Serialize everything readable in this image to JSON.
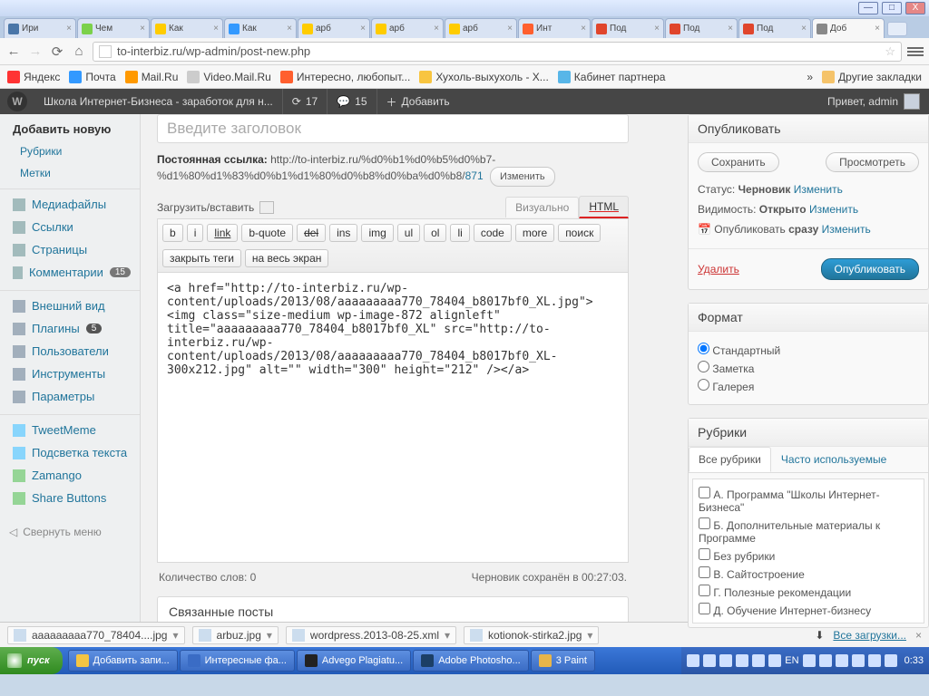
{
  "win_buttons": {
    "min": "—",
    "max": "□",
    "close": "X"
  },
  "browser_tabs": [
    {
      "label": "Ири",
      "color": "#4a76a8"
    },
    {
      "label": "Чем",
      "color": "#7bd14b"
    },
    {
      "label": "Как",
      "color": "#ffcc00"
    },
    {
      "label": "Как",
      "color": "#3399ff"
    },
    {
      "label": "арб",
      "color": "#ffcc00"
    },
    {
      "label": "арб",
      "color": "#ffcc00"
    },
    {
      "label": "арб",
      "color": "#ffcc00"
    },
    {
      "label": "Инт",
      "color": "#ff5f2e"
    },
    {
      "label": "Под",
      "color": "#e0452c"
    },
    {
      "label": "Под",
      "color": "#e0452c"
    },
    {
      "label": "Под",
      "color": "#e0452c"
    },
    {
      "label": "Доб",
      "color": "#888",
      "active": true
    }
  ],
  "omnibox": "to-interbiz.ru/wp-admin/post-new.php",
  "bookmarks": [
    {
      "label": "Яндекс",
      "color": "#ff3333"
    },
    {
      "label": "Почта",
      "color": "#3399ff"
    },
    {
      "label": "Mail.Ru",
      "color": "#ff9900"
    },
    {
      "label": "Video.Mail.Ru",
      "color": "#ccc"
    },
    {
      "label": "Интересно, любопыт...",
      "color": "#ff5f2e"
    },
    {
      "label": "Хухоль-выхухоль - Х...",
      "color": "#f8c540"
    },
    {
      "label": "Кабинет партнера",
      "color": "#58b6e8"
    }
  ],
  "bookmarks_more": "»",
  "bookmarks_other": "Другие закладки",
  "wpbar": {
    "site": "Школа Интернет-Бизнеса - заработок для н...",
    "updates": "17",
    "comments": "15",
    "add": "Добавить",
    "hello": "Привет, admin"
  },
  "sidebar": {
    "addnew": "Добавить новую",
    "sub1": "Рубрики",
    "sub2": "Метки",
    "media": "Медиафайлы",
    "links": "Ссылки",
    "pages": "Страницы",
    "comments": "Комментарии",
    "comments_badge": "15",
    "appearance": "Внешний вид",
    "plugins": "Плагины",
    "plugins_badge": "5",
    "users": "Пользователи",
    "tools": "Инструменты",
    "settings": "Параметры",
    "tweetmeme": "TweetMeme",
    "highlight": "Подсветка текста",
    "zamango": "Zamango",
    "share": "Share Buttons",
    "collapse": "Свернуть меню"
  },
  "editor": {
    "title_placeholder": "Введите заголовок",
    "perma_label": "Постоянная ссылка:",
    "perma_url": "http://to-interbiz.ru/%d0%b1%d0%b5%d0%b7-%d1%80%d1%83%d0%b1%d1%80%d0%b8%d0%ba%d0%b8/",
    "perma_id": "871",
    "change": "Изменить",
    "upload": "Загрузить/вставить",
    "tab_visual": "Визуально",
    "tab_html": "HTML",
    "tb": [
      "b",
      "i",
      "link",
      "b-quote",
      "del",
      "ins",
      "img",
      "ul",
      "ol",
      "li",
      "code",
      "more",
      "поиск"
    ],
    "tb2": [
      "закрыть теги",
      "на весь экран"
    ],
    "content": "<a href=\"http://to-interbiz.ru/wp-content/uploads/2013/08/aaaaaaaaa770_78404_b8017bf0_XL.jpg\"><img class=\"size-medium wp-image-872 alignleft\" title=\"aaaaaaaaa770_78404_b8017bf0_XL\" src=\"http://to-interbiz.ru/wp-content/uploads/2013/08/aaaaaaaaa770_78404_b8017bf0_XL-300x212.jpg\" alt=\"\" width=\"300\" height=\"212\" /></a>",
    "wc": "Количество слов: 0",
    "autosave": "Черновик сохранён в 00:27:03.",
    "related": "Связанные посты"
  },
  "publish": {
    "title": "Опубликовать",
    "save": "Сохранить",
    "preview": "Просмотреть",
    "status_l": "Статус:",
    "status_v": "Черновик",
    "vis_l": "Видимость:",
    "vis_v": "Открыто",
    "sched": "Опубликовать",
    "sched_v": "сразу",
    "edit": "Изменить",
    "delete": "Удалить",
    "submit": "Опубликовать"
  },
  "format": {
    "title": "Формат",
    "opts": [
      "Стандартный",
      "Заметка",
      "Галерея"
    ]
  },
  "cats": {
    "title": "Рубрики",
    "tab_all": "Все рубрики",
    "tab_pop": "Часто используемые",
    "items": [
      "А. Программа \"Школы Интернет-Бизнеса\"",
      "Б. Дополнительные материалы к Программе",
      "Без рубрики",
      "В. Сайтостроение",
      "Г. Полезные рекомендации",
      "Д. Обучение Интернет-бизнесу"
    ]
  },
  "downloads": {
    "items": [
      "aaaaaaaaa770_78404....jpg",
      "arbuz.jpg",
      "wordpress.2013-08-25.xml",
      "kotionok-stirka2.jpg"
    ],
    "all": "Все загрузки..."
  },
  "taskbar": {
    "start": "пуск",
    "tabs": [
      {
        "label": "Добавить запи...",
        "color": "#f4c542"
      },
      {
        "label": "Интересные фа...",
        "color": "#3a6cc5"
      },
      {
        "label": "Advego Plagiatu...",
        "color": "#222"
      },
      {
        "label": "Adobe Photosho...",
        "color": "#1c3f66"
      },
      {
        "label": "3 Paint",
        "color": "#e8b54a"
      }
    ],
    "lang": "EN",
    "clock": "0:33"
  }
}
